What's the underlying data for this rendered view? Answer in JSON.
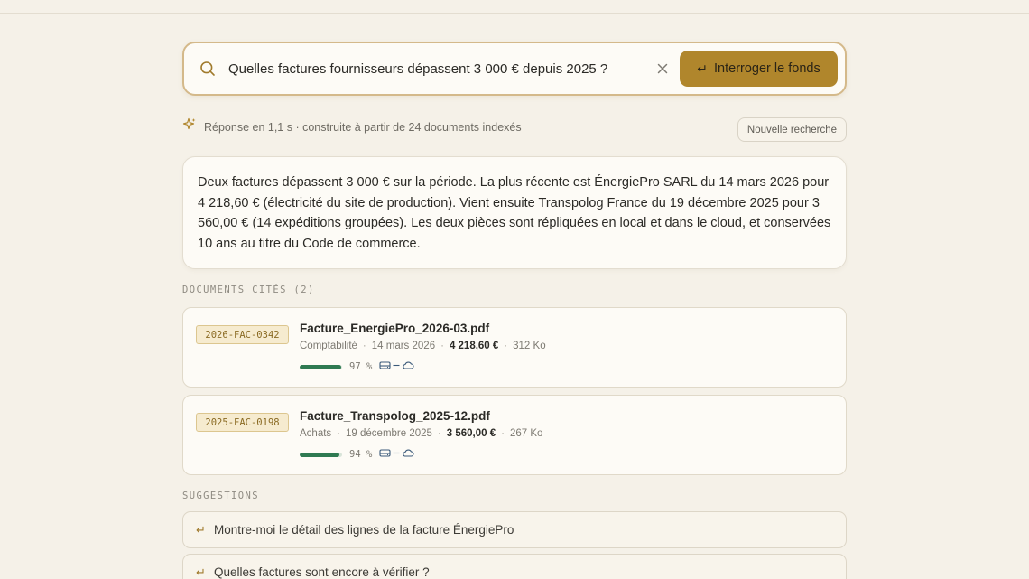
{
  "search": {
    "query": "Quelles factures fournisseurs dépassent 3 000 € depuis 2025 ?",
    "button_label": "Interroger le fonds",
    "search_icon": "search-icon",
    "clear_icon": "close-icon"
  },
  "meta": {
    "summary": "Réponse en 1,1 s · construite à partir de 24 documents indexés",
    "new_search_label": "Nouvelle recherche",
    "icon": "sparkle-icon"
  },
  "answer": {
    "text": "Deux factures dépassent 3 000 € sur la période. La plus récente est ÉnergiePro SARL du 14 mars 2026 pour 4 218,60 € (électricité du site de production). Vient ensuite Transpolog France du 19 décembre 2025 pour 3 560,00 € (14 expéditions groupées). Les deux pièces sont répliquées en local et dans le cloud, et conservées 10 ans au titre du Code de commerce."
  },
  "documents": {
    "label": "DOCUMENTS CITÉS (2)",
    "items": [
      {
        "code": "2026-FAC-0342",
        "filename": "Facture_EnergiePro_2026-03.pdf",
        "category": "Comptabilité",
        "date": "14 mars 2026",
        "amount": "4 218,60 €",
        "size": "312 Ko",
        "confidence": 97,
        "confidence_label": "97 %",
        "accent": "#2f7a52"
      },
      {
        "code": "2025-FAC-0198",
        "filename": "Facture_Transpolog_2025-12.pdf",
        "category": "Achats",
        "date": "19 décembre 2025",
        "amount": "3 560,00 €",
        "size": "267 Ko",
        "confidence": 94,
        "confidence_label": "94 %",
        "accent": "#2f7a52"
      }
    ]
  },
  "suggestions": {
    "label": "SUGGESTIONS",
    "items": [
      "Montre-moi le détail des lignes de la facture ÉnergiePro",
      "Quelles factures sont encore à vérifier ?"
    ]
  },
  "colors": {
    "accent": "#b0862c",
    "background": "#f5f1e8",
    "success": "#2f7a52"
  }
}
